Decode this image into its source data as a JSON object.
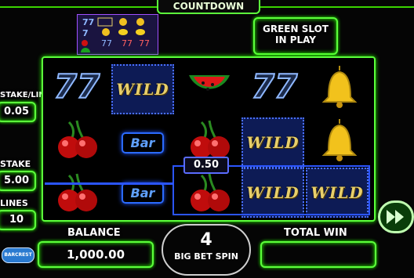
{
  "header": {
    "title": "COUNTDOWN"
  },
  "paytable": {
    "rows": [
      [
        "77",
        "BAR",
        "bell"
      ],
      [
        "7",
        "bell",
        "lemon"
      ],
      [
        "cherry",
        "7",
        "7"
      ],
      [
        "melon",
        "7",
        "7"
      ]
    ]
  },
  "mode": {
    "line1": "GREEN SLOT",
    "line2": "IN PLAY"
  },
  "left_panel": {
    "stake_line_label": "STAKE/LINE",
    "stake_line_value": "0.05",
    "stake_label": "STAKE",
    "stake_value": "5.00",
    "lines_label": "LINES",
    "lines_value": "10"
  },
  "reels": {
    "wild_text": "WILD",
    "bar_text": "Bar",
    "sevens_text": "77"
  },
  "win": {
    "line_amount": "0.50"
  },
  "bottom": {
    "balance_label": "BALANCE",
    "balance_value": "1,000.00",
    "bigbet_count": "4",
    "bigbet_label": "BIG BET SPIN",
    "total_win_label": "TOTAL WIN",
    "total_win_value": "",
    "logo_text": "BARCREST"
  },
  "colors": {
    "neon_green": "#5cff3c",
    "win_blue": "#2b55ff",
    "wild_gold": "#e8cf6a"
  }
}
